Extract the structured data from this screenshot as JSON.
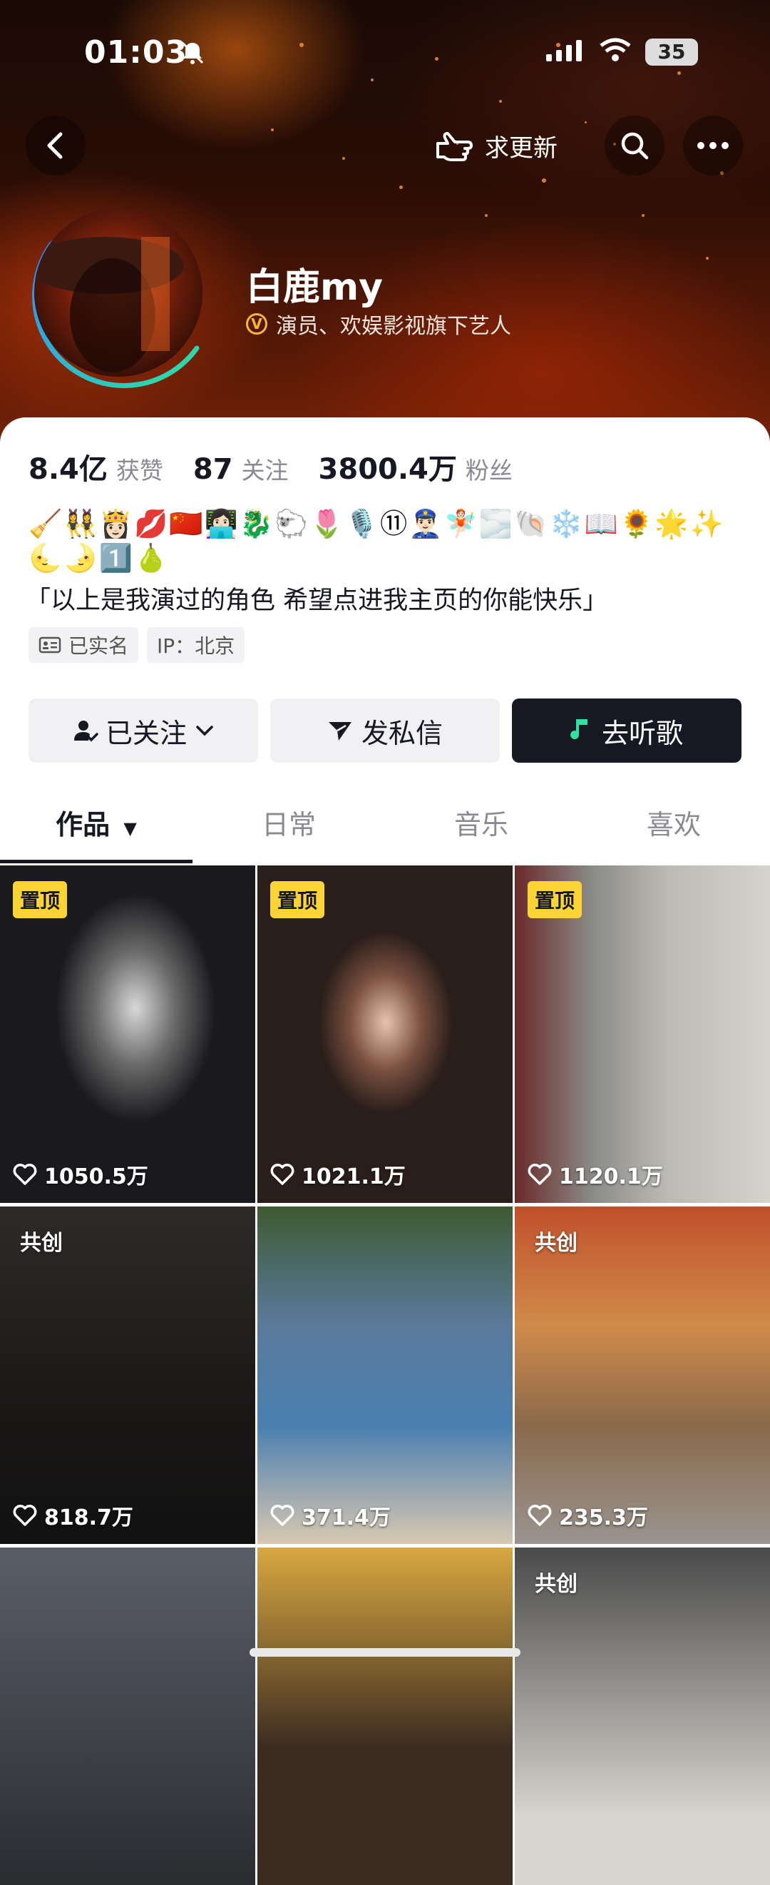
{
  "status_bar": {
    "time": "01:03",
    "battery": "35"
  },
  "nav": {
    "update_label": "求更新"
  },
  "profile": {
    "name": "白鹿my",
    "verify_badge": "V",
    "verification": "演员、欢娱影视旗下艺人",
    "stats": [
      {
        "value": "8.4亿",
        "label": "获赞"
      },
      {
        "value": "87",
        "label": "关注"
      },
      {
        "value": "3800.4万",
        "label": "粉丝"
      }
    ],
    "emoji_line1": "🧹👯‍♀️👸🏻💋🇨🇳👩🏻‍💻🐉🐑🌷🎙️⑪👮🏻‍♂️🧚🏻🌫️🐚❄️📖🌻🌟✨",
    "emoji_line2": "🌜🌛1️⃣🍐",
    "bio": "「以上是我演过的角色 希望点进我主页的你能快乐」",
    "tags": [
      "已实名",
      "IP：北京"
    ]
  },
  "actions": {
    "follow": "已关注",
    "message": "发私信",
    "music": "去听歌"
  },
  "tabs": [
    "作品",
    "日常",
    "音乐",
    "喜欢"
  ],
  "videos": [
    {
      "badge": "置顶",
      "likes": "1050.5万"
    },
    {
      "badge": "置顶",
      "likes": "1021.1万"
    },
    {
      "badge": "置顶",
      "likes": "1120.1万"
    },
    {
      "badge": "共创",
      "likes": "818.7万"
    },
    {
      "badge": "",
      "likes": "371.4万"
    },
    {
      "badge": "共创",
      "likes": "235.3万"
    },
    {
      "badge": "",
      "likes": ""
    },
    {
      "badge": "",
      "likes": ""
    },
    {
      "badge": "共创",
      "likes": ""
    }
  ]
}
